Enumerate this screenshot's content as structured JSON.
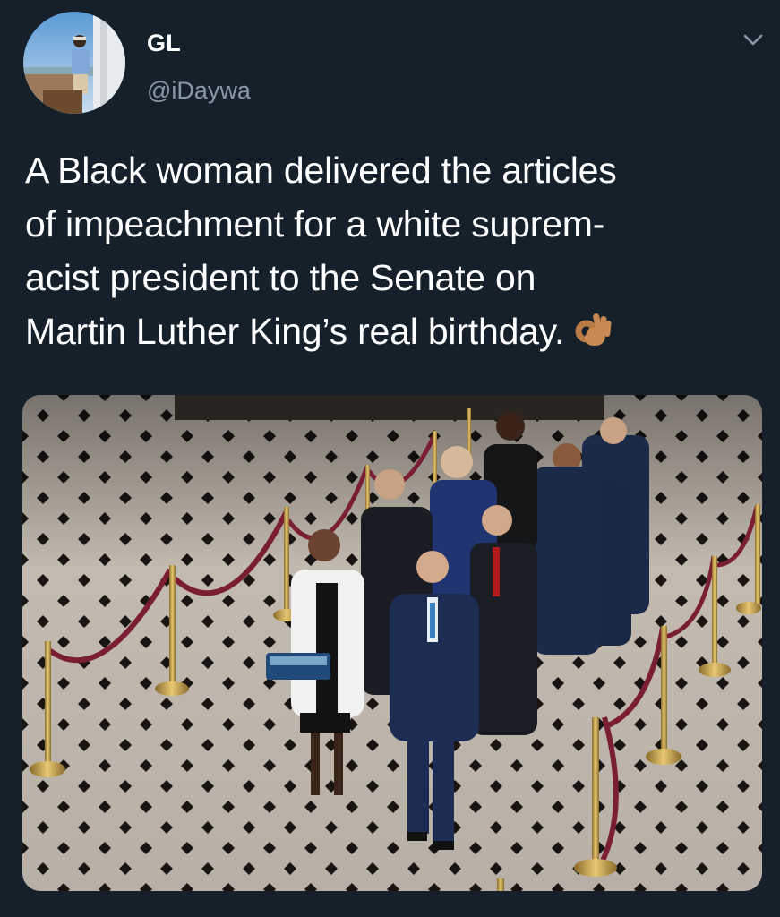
{
  "user": {
    "display_name": "GL",
    "handle": "@iDaywa"
  },
  "tweet": {
    "lines": [
      "A Black woman delivered the articles",
      "of impeachment for a white suprem-",
      "acist president to the Senate on",
      "Martin Luther King’s real birthday."
    ],
    "emoji": "ok-hand-emoji"
  },
  "icons": {
    "menu": "chevron-down-icon"
  },
  "colors": {
    "background": "#15202b",
    "secondary_text": "#8899a6",
    "primary_text": "#ffffff"
  }
}
